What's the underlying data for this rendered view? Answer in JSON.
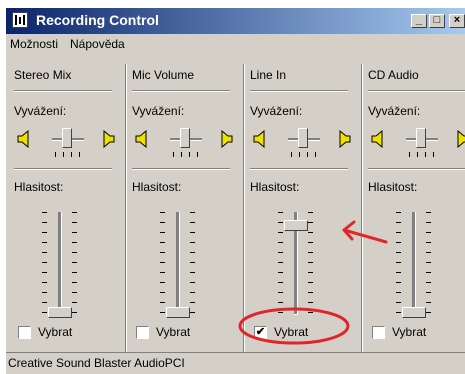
{
  "window": {
    "title": "Recording Control"
  },
  "titlebar_buttons": {
    "minimize": "_",
    "maximize": "□",
    "close": "×"
  },
  "menu": [
    {
      "label": "Možnosti"
    },
    {
      "label": "Nápověda"
    }
  ],
  "channels": [
    {
      "name": "Stereo Mix",
      "balance_label": "Vyvážení:",
      "volume_label": "Hlasitost:",
      "volume_level": 0.0,
      "select_label": "Vybrat",
      "selected": false,
      "check_mark": ""
    },
    {
      "name": "Mic Volume",
      "balance_label": "Vyvážení:",
      "volume_label": "Hlasitost:",
      "volume_level": 0.0,
      "select_label": "Vybrat",
      "selected": false,
      "check_mark": ""
    },
    {
      "name": "Line In",
      "balance_label": "Vyvážení:",
      "volume_label": "Hlasitost:",
      "volume_level": 0.87,
      "select_label": "Vybrat",
      "selected": true,
      "check_mark": "✔"
    },
    {
      "name": "CD Audio",
      "balance_label": "Vyvážení:",
      "volume_label": "Hlasitost:",
      "volume_level": 0.0,
      "select_label": "Vybrat",
      "selected": false,
      "check_mark": ""
    }
  ],
  "status": {
    "text": "Creative Sound Blaster AudioPCI"
  },
  "colors": {
    "title_gradient_start": "#0a246a",
    "title_gradient_end": "#a6caf0",
    "annotation": "#e0262a",
    "speaker": "#f0e000"
  }
}
